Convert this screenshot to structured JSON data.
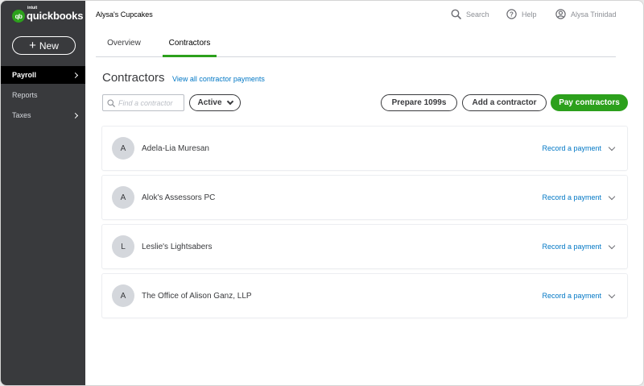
{
  "sidebar": {
    "logo_mark": "qb",
    "logo_intuit": "intuit",
    "logo_text": "quickbooks",
    "new_label": "New",
    "items": [
      {
        "label": "Payroll",
        "active": true
      },
      {
        "label": "Reports",
        "active": false
      },
      {
        "label": "Taxes",
        "active": false
      }
    ]
  },
  "header": {
    "company": "Alysa's Cupcakes",
    "search": "Search",
    "help": "Help",
    "user": "Alysa Trinidad"
  },
  "tabs": [
    {
      "label": "Overview",
      "active": false
    },
    {
      "label": "Contractors",
      "active": true
    }
  ],
  "contractors_page": {
    "title": "Contractors",
    "view_all_link": "View all contractor payments",
    "search_placeholder": "Find a contractor",
    "filter_value": "Active",
    "prepare_button": "Prepare 1099s",
    "add_button": "Add a contractor",
    "pay_button": "Pay contractors"
  },
  "contractors": [
    {
      "initial": "A",
      "name": "Adela-Lia Muresan",
      "action": "Record a payment"
    },
    {
      "initial": "A",
      "name": "Alok's Assessors PC",
      "action": "Record a payment"
    },
    {
      "initial": "L",
      "name": "Leslie's Lightsabers",
      "action": "Record a payment"
    },
    {
      "initial": "A",
      "name": "The Office of Alison Ganz, LLP",
      "action": "Record a payment"
    }
  ],
  "colors": {
    "brand_green": "#2ca01c",
    "sidebar_bg": "#393a3d",
    "link_blue": "#0077c5"
  },
  "icons": {
    "search": "search-icon",
    "help": "help-icon",
    "user": "user-icon",
    "chevron_right": "chevron-right-icon",
    "chevron_down": "chevron-down-icon"
  }
}
